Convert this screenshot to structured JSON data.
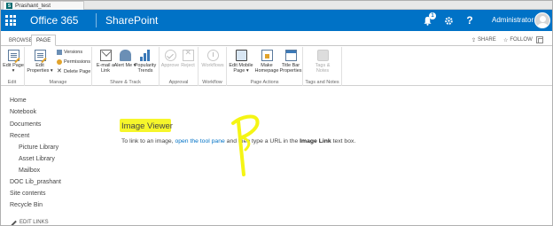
{
  "browser": {
    "tab_title": "Prashant_test",
    "favicon": "sp-favicon-icon"
  },
  "suitebar": {
    "brand": "Office 365",
    "app": "SharePoint",
    "notification_count": "1",
    "help": "?",
    "user_name": "Administrator",
    "user_caret": "▾",
    "accent": "#0072c6"
  },
  "ribbon_tabs": {
    "browse": "BROWSE",
    "page": "PAGE",
    "share": "SHARE",
    "follow": "FOLLOW"
  },
  "ribbon": {
    "edit": {
      "button": "Edit Page",
      "caret": "▾",
      "group": "Edit"
    },
    "manage": {
      "edit_properties": "Edit Properties",
      "caret": "▾",
      "versions": "Versions",
      "permissions": "Permissions",
      "delete_page": "Delete Page",
      "group": "Manage"
    },
    "share_track": {
      "email": "E-mail a Link",
      "alert": "Alert Me",
      "caret": "▾",
      "popularity": "Popularity Trends",
      "group": "Share & Track"
    },
    "approval": {
      "approve": "Approve",
      "reject": "Reject",
      "group": "Approval"
    },
    "workflow": {
      "workflows": "Workflows",
      "group": "Workflow"
    },
    "page_actions": {
      "edit_mobile": "Edit Mobile Page",
      "caret": "▾",
      "make_homepage": "Make Homepage",
      "title_bar": "Title Bar Properties",
      "group": "Page Actions"
    },
    "tags_notes": {
      "tags": "Tags & Notes",
      "group": "Tags and Notes"
    }
  },
  "leftnav": {
    "items": [
      "Home",
      "Notebook",
      "Documents",
      "Recent",
      "Picture Library",
      "Asset Library",
      "Mailbox",
      "DOC Lib_prashant",
      "Site contents",
      "Recycle Bin"
    ],
    "edit_links": "EDIT LINKS"
  },
  "main": {
    "title": "Image Viewer",
    "instr_before": "To link to an image, ",
    "instr_link": "open the tool pane",
    "instr_middle": " and then type a URL in the ",
    "instr_bold": "Image Link",
    "instr_after": " text box.",
    "highlight_color": "#f5f514"
  }
}
